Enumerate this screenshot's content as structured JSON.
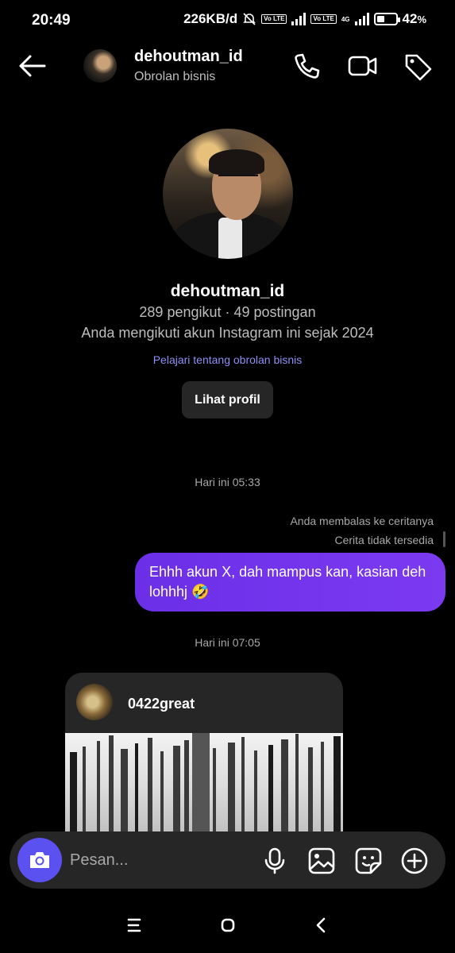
{
  "status_bar": {
    "time": "20:49",
    "network_speed": "226KB/d",
    "volte_tag": "Vo LTE",
    "lte_tag": "4G",
    "battery": "42",
    "battery_unit": "%",
    "battery_level": 0.42
  },
  "header": {
    "username": "dehoutman_id",
    "subtitle": "Obrolan bisnis",
    "icons": [
      "back-arrow-icon",
      "phone-icon",
      "video-call-icon",
      "tag-icon"
    ]
  },
  "profile": {
    "username": "dehoutman_id",
    "stats": "289 pengikut · 49 postingan",
    "follow_since": "Anda mengikuti akun Instagram ini sejak 2024",
    "learn_link": "Pelajari tentang obrolan bisnis",
    "view_profile_label": "Lihat profil"
  },
  "messages": {
    "timestamp_1": "Hari ini 05:33",
    "reply_note": "Anda membalas ke ceritanya",
    "story_unavailable": "Cerita tidak tersedia",
    "outgoing_text": "Ehhh akun X, dah mampus kan, kasian deh lohhhj 🤣",
    "timestamp_2": "Hari ini 07:05",
    "shared_post_user": "0422great"
  },
  "composer": {
    "placeholder": "Pesan...",
    "icons": [
      "camera-icon",
      "microphone-icon",
      "gallery-icon",
      "sticker-icon",
      "plus-circle-icon"
    ],
    "camera_color": "#5b51f0"
  },
  "theme": {
    "background": "#000000",
    "bubble_color": "#7434ec",
    "link_color": "#8f8ff5"
  }
}
